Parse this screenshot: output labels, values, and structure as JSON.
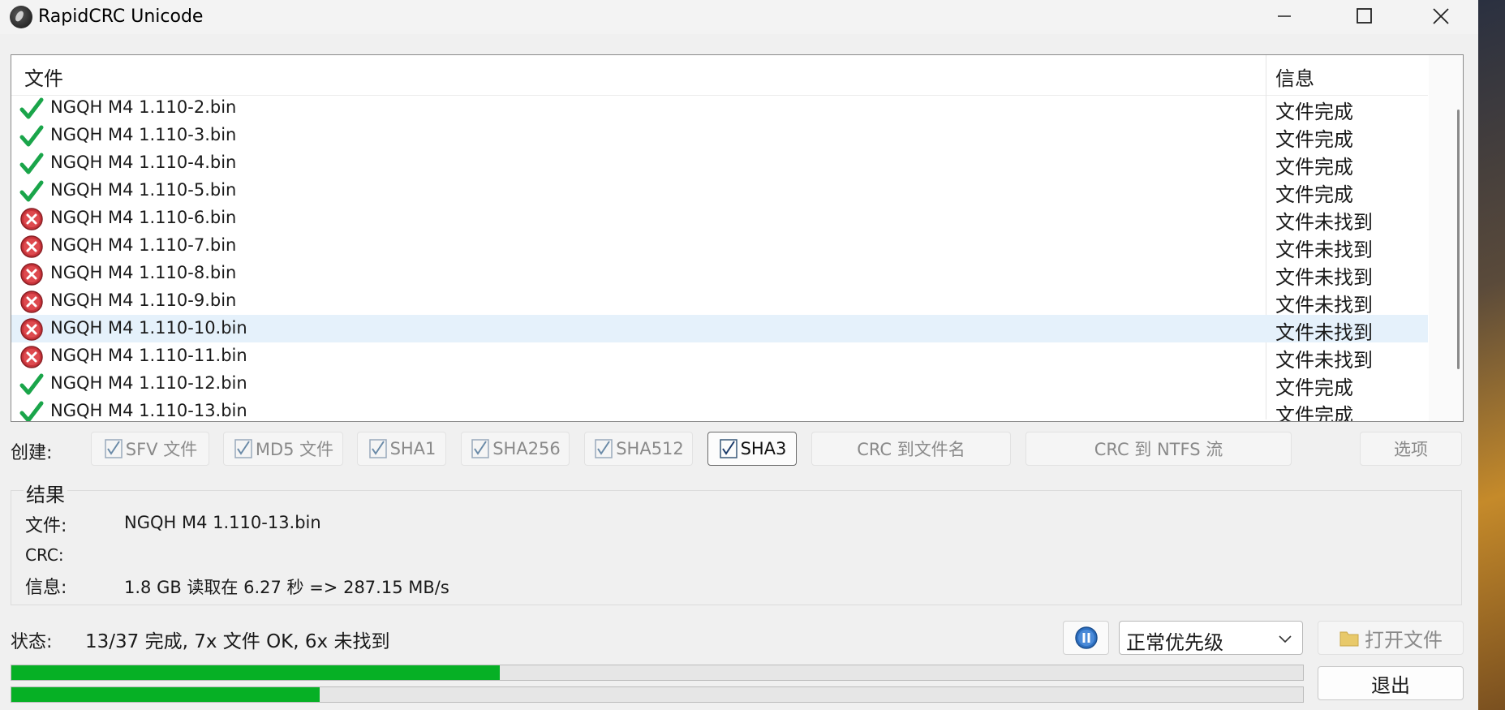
{
  "window": {
    "title": "RapidCRC Unicode",
    "minimize_icon": "minimize-icon",
    "maximize_icon": "maximize-icon",
    "close_icon": "close-icon"
  },
  "list": {
    "columns": {
      "file": "文件",
      "info": "信息"
    },
    "rows": [
      {
        "name": "NGQH M4 1.110-2.bin",
        "info": "文件完成",
        "status": "ok"
      },
      {
        "name": "NGQH M4 1.110-3.bin",
        "info": "文件完成",
        "status": "ok"
      },
      {
        "name": "NGQH M4 1.110-4.bin",
        "info": "文件完成",
        "status": "ok"
      },
      {
        "name": "NGQH M4 1.110-5.bin",
        "info": "文件完成",
        "status": "ok"
      },
      {
        "name": "NGQH M4 1.110-6.bin",
        "info": "文件未找到",
        "status": "missing"
      },
      {
        "name": "NGQH M4 1.110-7.bin",
        "info": "文件未找到",
        "status": "missing"
      },
      {
        "name": "NGQH M4 1.110-8.bin",
        "info": "文件未找到",
        "status": "missing"
      },
      {
        "name": "NGQH M4 1.110-9.bin",
        "info": "文件未找到",
        "status": "missing"
      },
      {
        "name": "NGQH M4 1.110-10.bin",
        "info": "文件未找到",
        "status": "missing",
        "selected": true
      },
      {
        "name": "NGQH M4 1.110-11.bin",
        "info": "文件未找到",
        "status": "missing"
      },
      {
        "name": "NGQH M4 1.110-12.bin",
        "info": "文件完成",
        "status": "ok"
      },
      {
        "name": "NGQH M4 1.110-13.bin",
        "info": "文件完成",
        "status": "ok"
      }
    ]
  },
  "create": {
    "label": "创建:",
    "buttons": {
      "sfv": "SFV 文件",
      "md5": "MD5 文件",
      "sha1": "SHA1",
      "sha256": "SHA256",
      "sha512": "SHA512",
      "sha3": "SHA3",
      "crc_filename": "CRC 到文件名",
      "crc_ntfs": "CRC 到 NTFS 流",
      "options": "选项"
    }
  },
  "result": {
    "legend": "结果",
    "file_label": "文件:",
    "file_value": "NGQH M4 1.110-13.bin",
    "crc_label": "CRC:",
    "crc_value": "",
    "info_label": "信息:",
    "info_value": "1.8 GB 读取在 6.27 秒 => 287.15 MB/s"
  },
  "status": {
    "label": "状态:",
    "text": "13/37 完成, 7x 文件 OK, 6x 未找到",
    "priority": "正常优先级",
    "open_files": "打开文件",
    "exit": "退出",
    "progress_file": 0.378,
    "progress_total": 0.239
  },
  "colors": {
    "ok": "#1aa54a",
    "missing": "#c8333a",
    "progress": "#06b025",
    "selected_row": "#e5f1fb"
  }
}
